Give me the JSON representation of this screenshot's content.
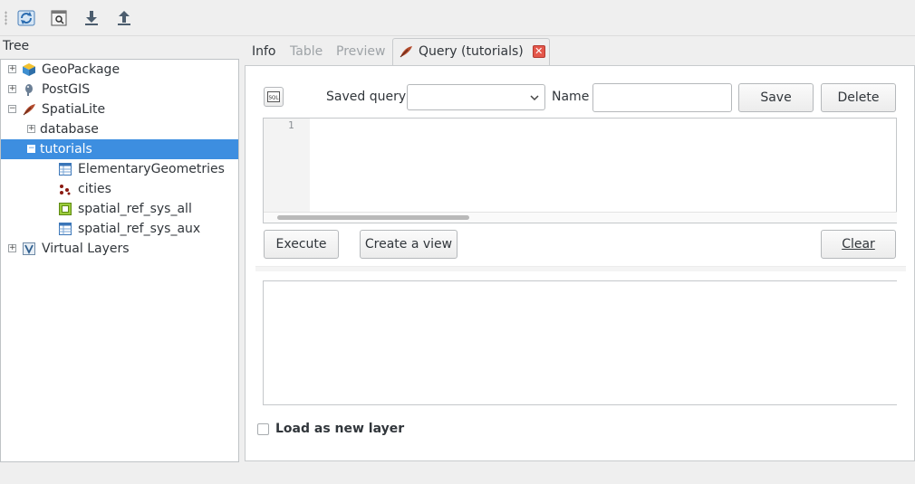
{
  "toolbar": {
    "buttons": [
      {
        "icon": "refresh-icon"
      },
      {
        "icon": "sql-window-icon"
      },
      {
        "icon": "import-layer-icon"
      },
      {
        "icon": "export-file-icon"
      }
    ]
  },
  "tree": {
    "title": "Tree",
    "items": [
      {
        "label": "GeoPackage",
        "icon": "geopackage-icon",
        "expander": "+"
      },
      {
        "label": "PostGIS",
        "icon": "postgis-elephant-icon",
        "expander": "+"
      },
      {
        "label": "SpatiaLite",
        "icon": "spatialite-feather-icon",
        "expander": "−"
      },
      {
        "label": "database",
        "expander": "+"
      },
      {
        "label": "tutorials",
        "expander": "−",
        "selected": true
      },
      {
        "label": "ElementaryGeometries",
        "icon": "table-icon"
      },
      {
        "label": "cities",
        "icon": "point-layer-icon"
      },
      {
        "label": "spatial_ref_sys_all",
        "icon": "view-icon"
      },
      {
        "label": "spatial_ref_sys_aux",
        "icon": "table-icon"
      },
      {
        "label": "Virtual Layers",
        "icon": "virtual-layers-icon",
        "expander": "+"
      }
    ]
  },
  "tabs": {
    "info": "Info",
    "table": "Table",
    "preview": "Preview",
    "query": "Query (tutorials)",
    "active": "query"
  },
  "query": {
    "saved_query_label": "Saved query",
    "saved_query_value": "",
    "name_label": "Name",
    "name_value": "",
    "save_button": "Save",
    "delete_button": "Delete",
    "line_number": "1",
    "editor_text": "",
    "execute_button": "Execute",
    "create_view_button": "Create a view",
    "clear_button": "Clear",
    "load_as_new_layer": "Load as new layer",
    "load_as_new_layer_checked": false
  },
  "colors": {
    "selection": "#3d8ee0",
    "close_button": "#e4574b"
  }
}
